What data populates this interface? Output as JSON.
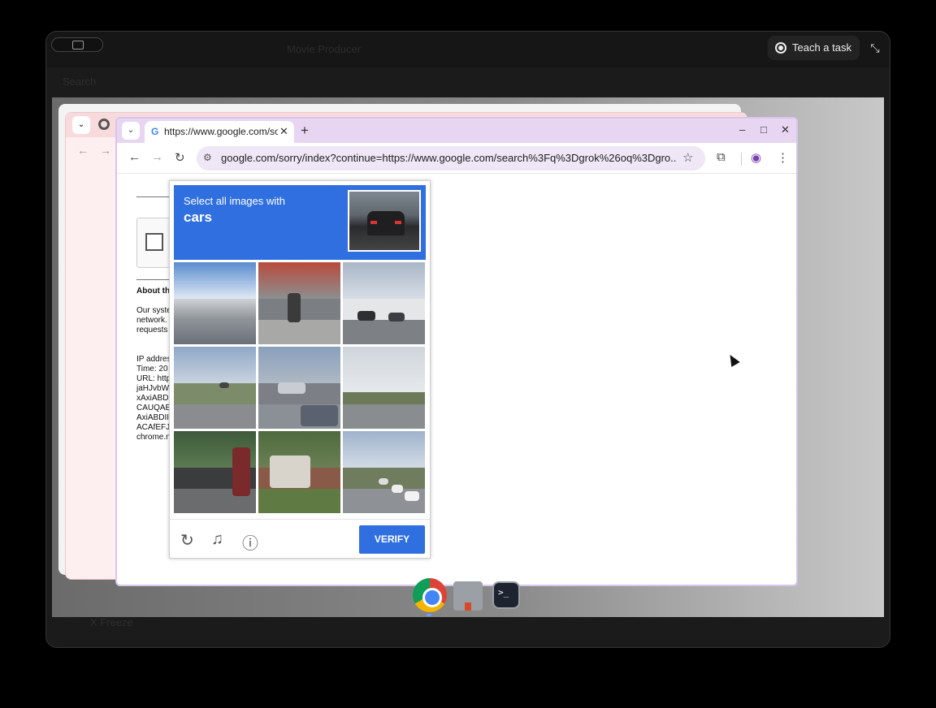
{
  "shell": {
    "ghost_title": "Movie Producer",
    "ghost_search": "Search",
    "ghost_bottom": "X Freeze",
    "teach_label": "Teach a task",
    "collapse_icon": "collapse-icon"
  },
  "browser": {
    "tab_title": "https://www.google.com/sorry/index?continue=https://www.google.com/search",
    "tab_favicon": "G",
    "new_tab": "+",
    "url": "google.com/sorry/index?continue=https://www.google.com/search%3Fq%3Dgrok%26oq%3Dgro...",
    "window_controls": [
      "–",
      "□",
      "✕"
    ]
  },
  "page": {
    "about_heading": "About th",
    "body_lines": [
      "Our syste",
      "network.",
      "requests"
    ],
    "details_lines": [
      "IP addres",
      "Time: 20",
      "URL: http",
      "jaHJvbW",
      "xAxiABD",
      "CAUQAE",
      "AxiABDII",
      "ACAfEFJ",
      "chrome.n"
    ]
  },
  "captcha": {
    "instruction": "Select all images with",
    "target": "cars",
    "verify_label": "VERIFY",
    "tiles": [
      "highway-overpass",
      "cyclist-storefront",
      "building-parking",
      "highway-traffic",
      "street-cars",
      "bridge-sky",
      "gate-bicycle",
      "house-lawn",
      "road-cars"
    ]
  },
  "colors": {
    "captcha_blue": "#2f6fe0",
    "tab_bar": "#e7d5f2"
  }
}
